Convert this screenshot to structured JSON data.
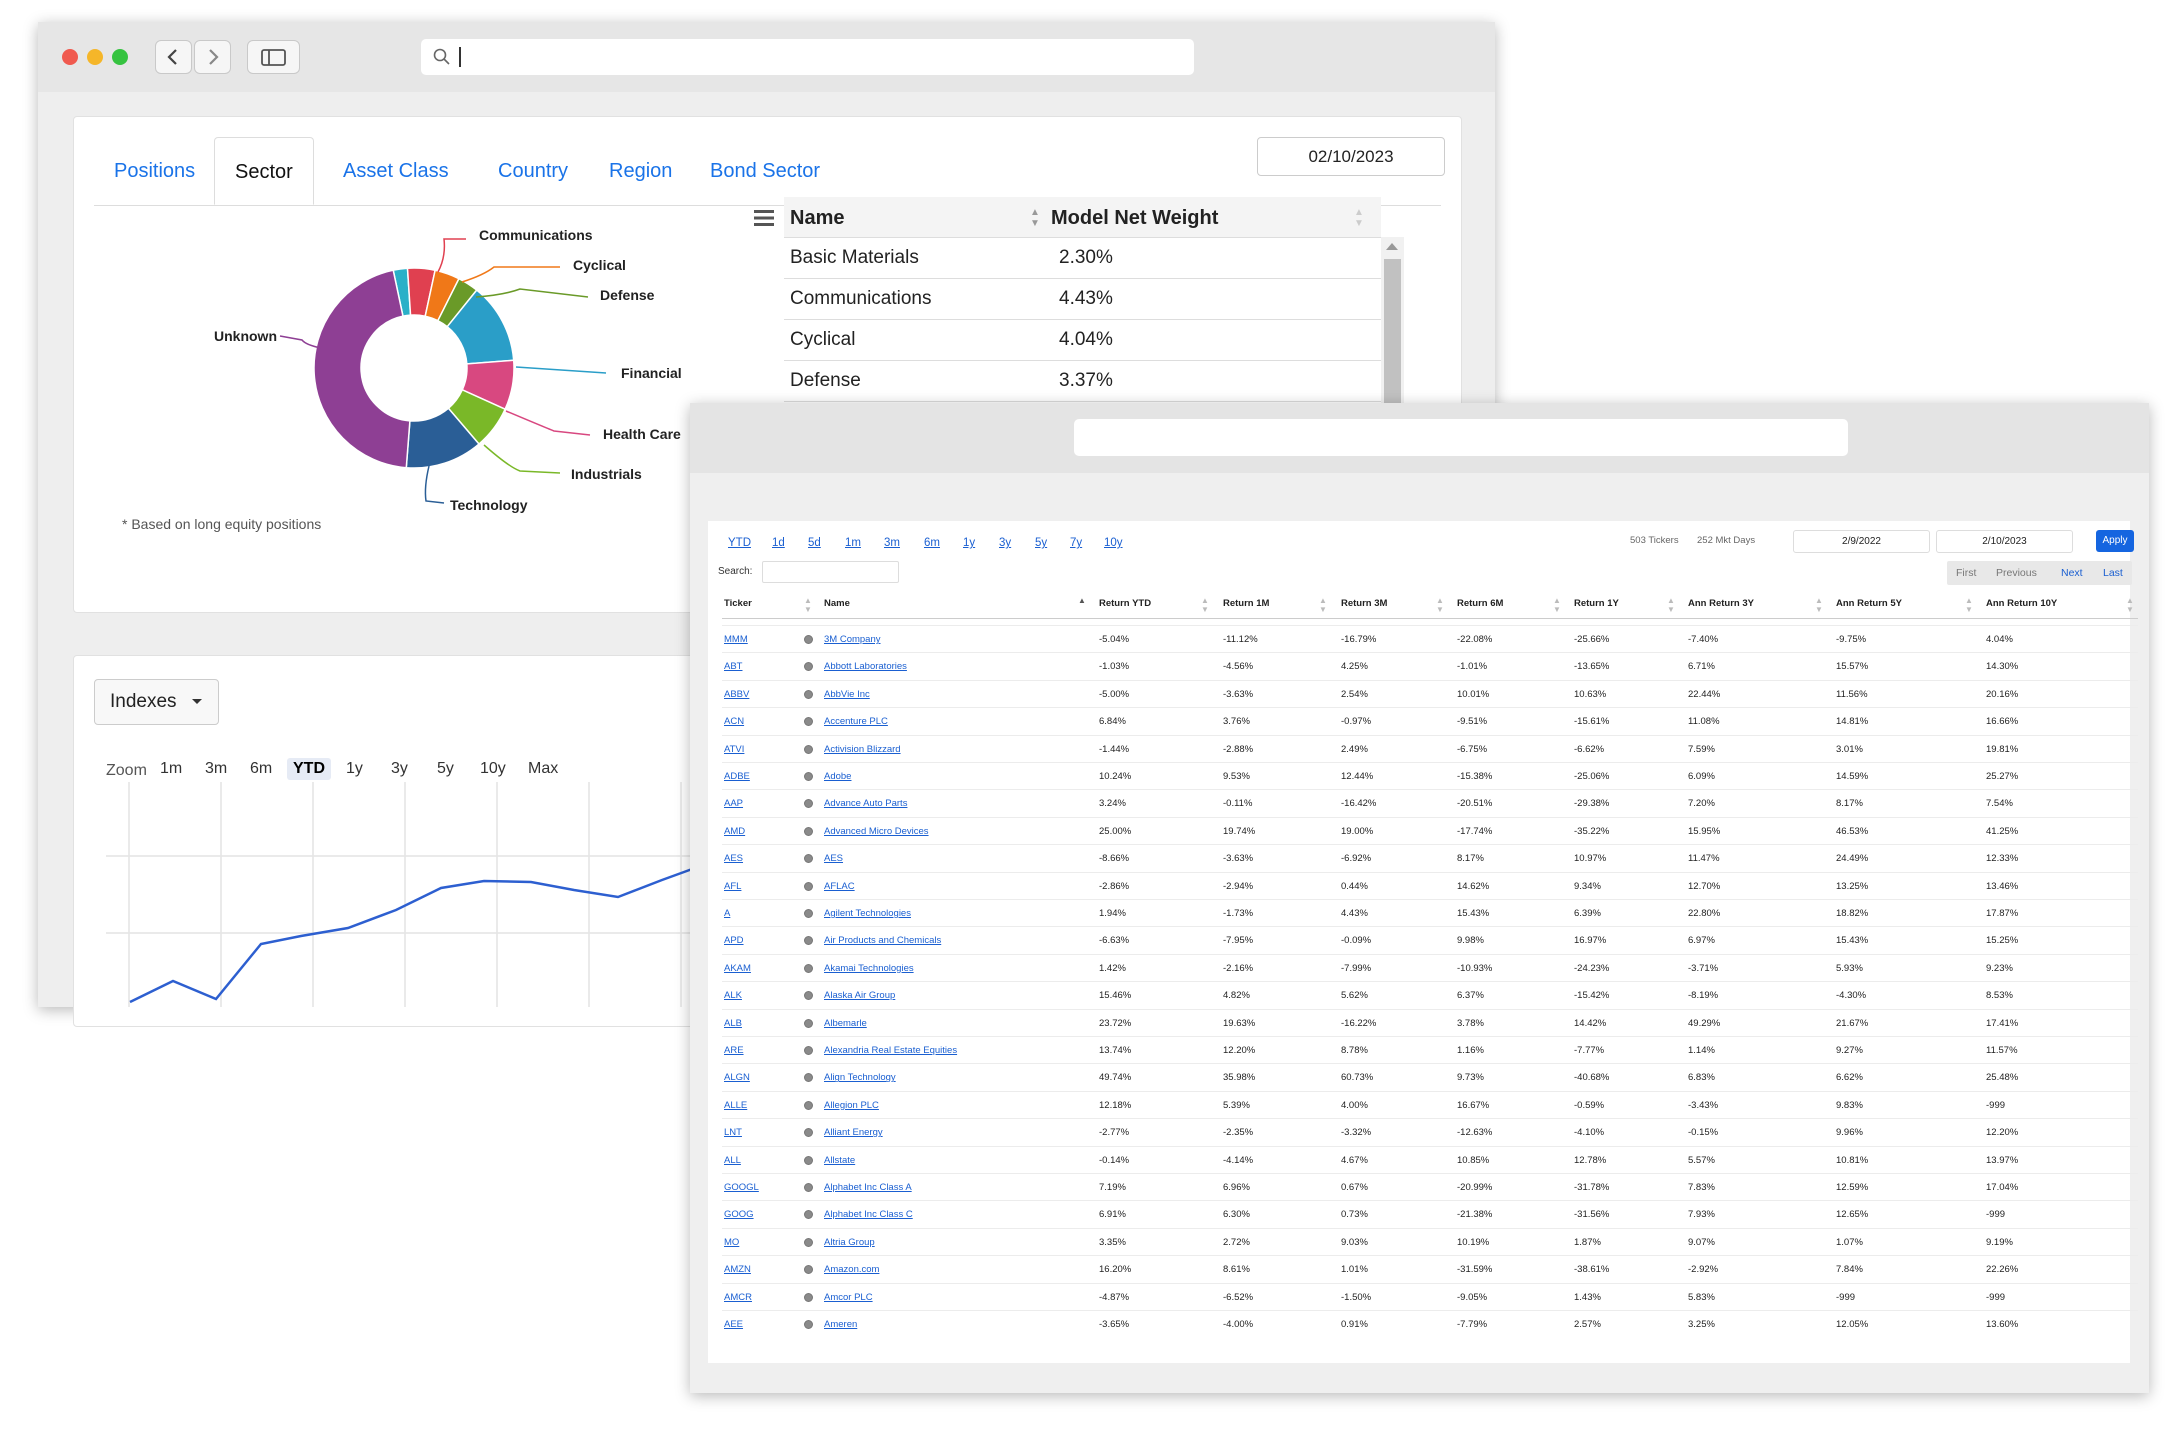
{
  "window1": {
    "tabs": [
      "Positions",
      "Sector",
      "Asset Class",
      "Country",
      "Region",
      "Bond Sector"
    ],
    "active_tab": "Sector",
    "date": "02/10/2023",
    "footnote": "* Based on long equity positions",
    "sector_table": {
      "headers": [
        "Name",
        "Model Net Weight"
      ],
      "rows": [
        [
          "Basic Materials",
          "2.30%"
        ],
        [
          "Communications",
          "4.43%"
        ],
        [
          "Cyclical",
          "4.04%"
        ],
        [
          "Defense",
          "3.37%"
        ]
      ]
    },
    "pie_labels": [
      "Communications",
      "Cyclical",
      "Defense",
      "Financial",
      "Health Care",
      "Industrials",
      "Technology",
      "Unknown"
    ],
    "indexes": {
      "dropdown_label": "Indexes",
      "zoom_label": "Zoom",
      "zoom_options": [
        "1m",
        "3m",
        "6m",
        "YTD",
        "1y",
        "3y",
        "5y",
        "10y",
        "Max"
      ],
      "active_zoom": "YTD"
    }
  },
  "chart_data": {
    "type": "pie",
    "categories": [
      "Basic Materials",
      "Communications",
      "Cyclical",
      "Defense",
      "Financial",
      "Health Care",
      "Industrials",
      "Technology",
      "Unknown"
    ],
    "values": [
      2.3,
      4.43,
      4.04,
      3.37,
      13.0,
      8.0,
      7.0,
      12.5,
      45.5
    ],
    "colors": [
      "#2ab0c8",
      "#e04050",
      "#f07818",
      "#6a9a28",
      "#2a9ec8",
      "#d84880",
      "#7ab828",
      "#2a5e96",
      "#8e3f94"
    ]
  },
  "window2": {
    "period_links": [
      "YTD",
      "1d",
      "5d",
      "1m",
      "3m",
      "6m",
      "1y",
      "3y",
      "5y",
      "7y",
      "10y"
    ],
    "tickers_count": "503 Tickers",
    "mkt_days": "252 Mkt Days",
    "start_date": "2/9/2022",
    "end_date": "2/10/2023",
    "apply_label": "Apply",
    "search_label": "Search:",
    "pager": [
      "First",
      "Previous",
      "Next",
      "Last"
    ],
    "headers": [
      "Ticker",
      "Name",
      "Return YTD",
      "Return 1M",
      "Return 3M",
      "Return 6M",
      "Return 1Y",
      "Ann Return 3Y",
      "Ann Return 5Y",
      "Ann Return 10Y"
    ],
    "rows": [
      [
        "MMM",
        "3M Company",
        "-5.04%",
        "-11.12%",
        "-16.79%",
        "-22.08%",
        "-25.66%",
        "-7.40%",
        "-9.75%",
        "4.04%"
      ],
      [
        "ABT",
        "Abbott Laboratories",
        "-1.03%",
        "-4.56%",
        "4.25%",
        "-1.01%",
        "-13.65%",
        "6.71%",
        "15.57%",
        "14.30%"
      ],
      [
        "ABBV",
        "AbbVie Inc",
        "-5.00%",
        "-3.63%",
        "2.54%",
        "10.01%",
        "10.63%",
        "22.44%",
        "11.56%",
        "20.16%"
      ],
      [
        "ACN",
        "Accenture PLC",
        "6.84%",
        "3.76%",
        "-0.97%",
        "-9.51%",
        "-15.61%",
        "11.08%",
        "14.81%",
        "16.66%"
      ],
      [
        "ATVI",
        "Activision Blizzard",
        "-1.44%",
        "-2.88%",
        "2.49%",
        "-6.75%",
        "-6.62%",
        "7.59%",
        "3.01%",
        "19.81%"
      ],
      [
        "ADBE",
        "Adobe",
        "10.24%",
        "9.53%",
        "12.44%",
        "-15.38%",
        "-25.06%",
        "6.09%",
        "14.59%",
        "25.27%"
      ],
      [
        "AAP",
        "Advance Auto Parts",
        "3.24%",
        "-0.11%",
        "-16.42%",
        "-20.51%",
        "-29.38%",
        "7.20%",
        "8.17%",
        "7.54%"
      ],
      [
        "AMD",
        "Advanced Micro Devices",
        "25.00%",
        "19.74%",
        "19.00%",
        "-17.74%",
        "-35.22%",
        "15.95%",
        "46.53%",
        "41.25%"
      ],
      [
        "AES",
        "AES",
        "-8.66%",
        "-3.63%",
        "-6.92%",
        "8.17%",
        "10.97%",
        "11.47%",
        "24.49%",
        "12.33%"
      ],
      [
        "AFL",
        "AFLAC",
        "-2.86%",
        "-2.94%",
        "0.44%",
        "14.62%",
        "9.34%",
        "12.70%",
        "13.25%",
        "13.46%"
      ],
      [
        "A",
        "Agilent Technologies",
        "1.94%",
        "-1.73%",
        "4.43%",
        "15.43%",
        "6.39%",
        "22.80%",
        "18.82%",
        "17.87%"
      ],
      [
        "APD",
        "Air Products and Chemicals",
        "-6.63%",
        "-7.95%",
        "-0.09%",
        "9.98%",
        "16.97%",
        "6.97%",
        "15.43%",
        "15.25%"
      ],
      [
        "AKAM",
        "Akamai Technologies",
        "1.42%",
        "-2.16%",
        "-7.99%",
        "-10.93%",
        "-24.23%",
        "-3.71%",
        "5.93%",
        "9.23%"
      ],
      [
        "ALK",
        "Alaska Air Group",
        "15.46%",
        "4.82%",
        "5.62%",
        "6.37%",
        "-15.42%",
        "-8.19%",
        "-4.30%",
        "8.53%"
      ],
      [
        "ALB",
        "Albemarle",
        "23.72%",
        "19.63%",
        "-16.22%",
        "3.78%",
        "14.42%",
        "49.29%",
        "21.67%",
        "17.41%"
      ],
      [
        "ARE",
        "Alexandria Real Estate Equities",
        "13.74%",
        "12.20%",
        "8.78%",
        "1.16%",
        "-7.77%",
        "1.14%",
        "9.27%",
        "11.57%"
      ],
      [
        "ALGN",
        "Align Technology",
        "49.74%",
        "35.98%",
        "60.73%",
        "9.73%",
        "-40.68%",
        "6.83%",
        "6.62%",
        "25.48%"
      ],
      [
        "ALLE",
        "Allegion PLC",
        "12.18%",
        "5.39%",
        "4.00%",
        "16.67%",
        "-0.59%",
        "-3.43%",
        "9.83%",
        "-999"
      ],
      [
        "LNT",
        "Alliant Energy",
        "-2.77%",
        "-2.35%",
        "-3.32%",
        "-12.63%",
        "-4.10%",
        "-0.15%",
        "9.96%",
        "12.20%"
      ],
      [
        "ALL",
        "Allstate",
        "-0.14%",
        "-4.14%",
        "4.67%",
        "10.85%",
        "12.78%",
        "5.57%",
        "10.81%",
        "13.97%"
      ],
      [
        "GOOGL",
        "Alphabet Inc Class A",
        "7.19%",
        "6.96%",
        "0.67%",
        "-20.99%",
        "-31.78%",
        "7.83%",
        "12.59%",
        "17.04%"
      ],
      [
        "GOOG",
        "Alphabet Inc Class C",
        "6.91%",
        "6.30%",
        "0.73%",
        "-21.38%",
        "-31.56%",
        "7.93%",
        "12.65%",
        "-999"
      ],
      [
        "MO",
        "Altria Group",
        "3.35%",
        "2.72%",
        "9.03%",
        "10.19%",
        "1.87%",
        "9.07%",
        "1.07%",
        "9.19%"
      ],
      [
        "AMZN",
        "Amazon.com",
        "16.20%",
        "8.61%",
        "1.01%",
        "-31.59%",
        "-38.61%",
        "-2.92%",
        "7.84%",
        "22.26%"
      ],
      [
        "AMCR",
        "Amcor PLC",
        "-4.87%",
        "-6.52%",
        "-1.50%",
        "-9.05%",
        "1.43%",
        "5.83%",
        "-999",
        "-999"
      ],
      [
        "AEE",
        "Ameren",
        "-3.65%",
        "-4.00%",
        "0.91%",
        "-7.79%",
        "2.57%",
        "3.25%",
        "12.05%",
        "13.60%"
      ]
    ]
  }
}
